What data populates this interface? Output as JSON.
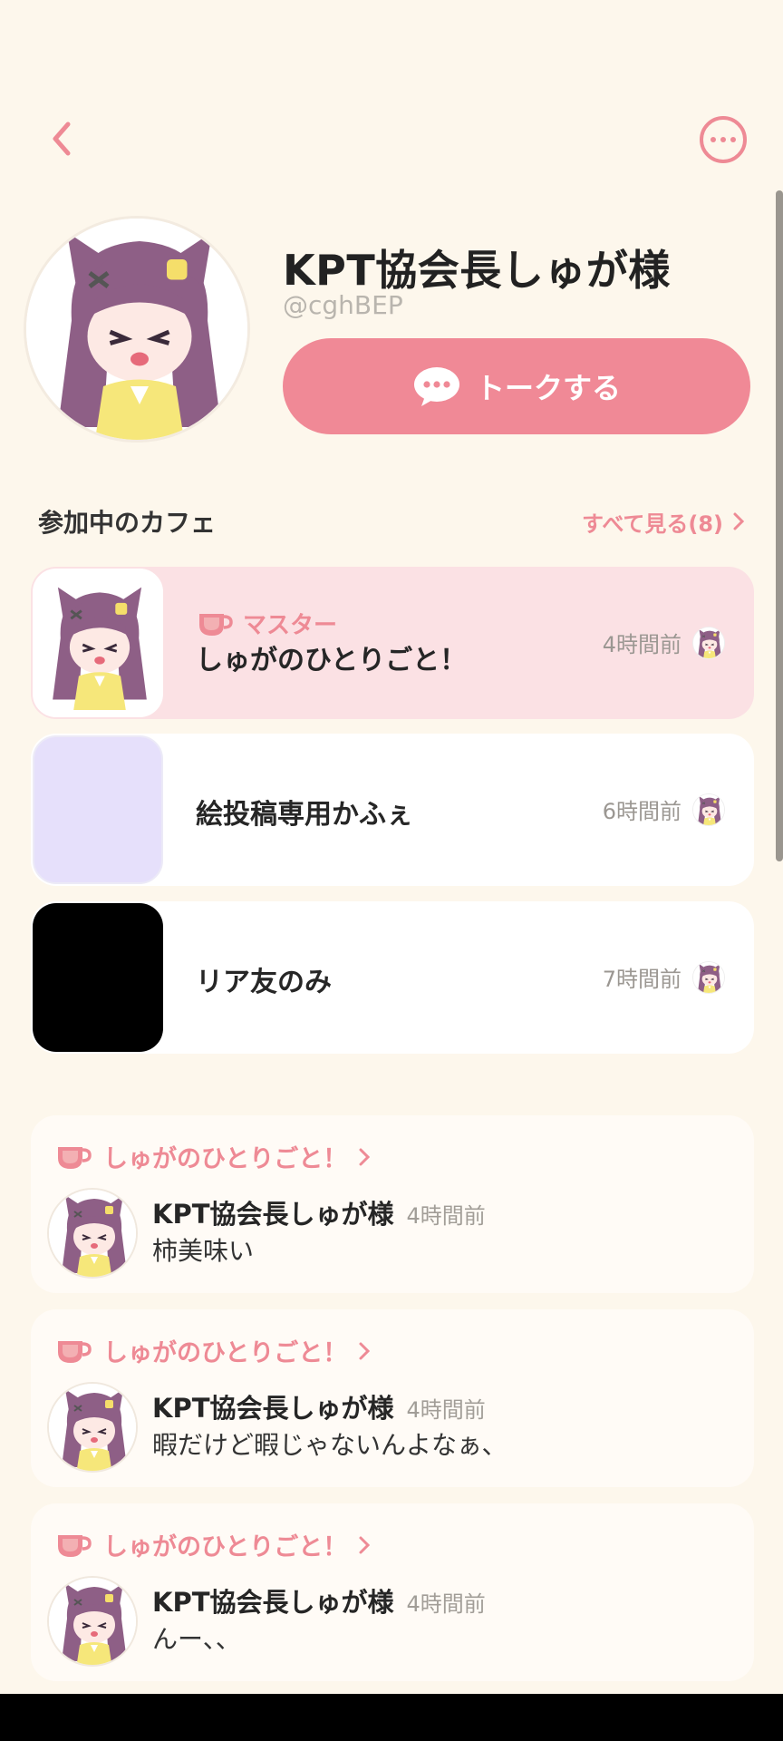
{
  "profile": {
    "name": "KPT協会長しゅが様",
    "handle": "@cghBEP",
    "talk_label": "トークする"
  },
  "cafes_section": {
    "title": "参加中のカフェ",
    "see_all": "すべて見る(8)"
  },
  "cafes": [
    {
      "role": "マスター",
      "name": "しゅがのひとりごと！",
      "time": "4時間前",
      "thumb": "character-avatar"
    },
    {
      "role": "",
      "name": "絵投稿専用かふぇ",
      "time": "6時間前",
      "thumb": "lavender-placeholder"
    },
    {
      "role": "",
      "name": "リア友のみ",
      "time": "7時間前",
      "thumb": "black-image"
    }
  ],
  "posts": [
    {
      "cafe": "しゅがのひとりごと！",
      "author": "KPT協会長しゅが様",
      "time": "4時間前",
      "text": "柿美味い"
    },
    {
      "cafe": "しゅがのひとりごと！",
      "author": "KPT協会長しゅが様",
      "time": "4時間前",
      "text": "暇だけど暇じゃないんよなぁ、"
    },
    {
      "cafe": "しゅがのひとりごと！",
      "author": "KPT協会長しゅが様",
      "time": "4時間前",
      "text": "んー、、"
    }
  ],
  "colors": {
    "accent": "#f08996",
    "background": "#fdf7ec",
    "active_card": "#fbe1e4"
  }
}
